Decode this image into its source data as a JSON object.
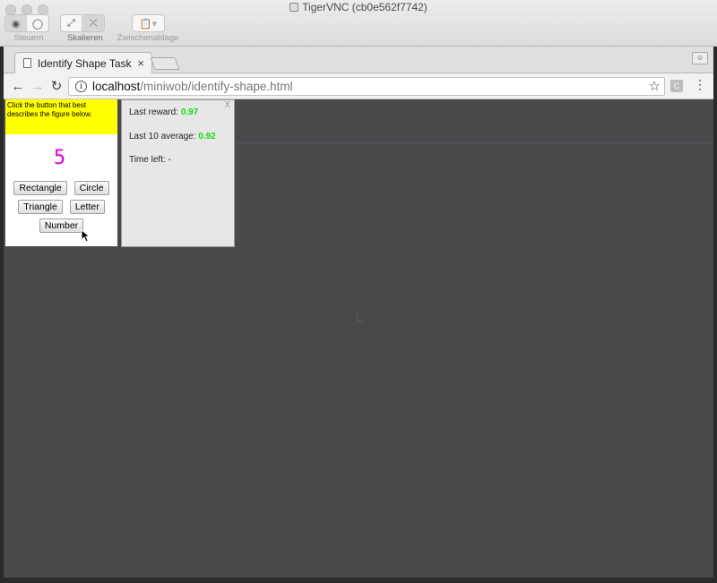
{
  "window": {
    "title": "TigerVNC (cb0e562f7742)",
    "toolbar": {
      "steuern_label": "Steuern",
      "skalieren_label": "Skalieren",
      "zwischenablage_label": "Zwischenablage"
    }
  },
  "browser": {
    "tab": {
      "title": "Identify Shape Task",
      "close": "×"
    },
    "address": {
      "host": "localhost",
      "path": "/miniwob/identify-shape.html"
    },
    "extension_icon": "C"
  },
  "task": {
    "query": "Click the button that best describes the figure below.",
    "figure": "5",
    "figure_color": "#e000e0",
    "buttons": [
      "Rectangle",
      "Circle",
      "Triangle",
      "Letter",
      "Number"
    ]
  },
  "reward_panel": {
    "close": "X",
    "last_reward_label": "Last reward:",
    "last_reward_value": "0.97",
    "last10_label": "Last 10 average:",
    "last10_value": "0.92",
    "time_left_label": "Time left:",
    "time_left_value": "-"
  },
  "colors": {
    "query_bg": "#ffff00",
    "reward_value": "#11dd11",
    "viewport_bg": "#4a484b"
  }
}
